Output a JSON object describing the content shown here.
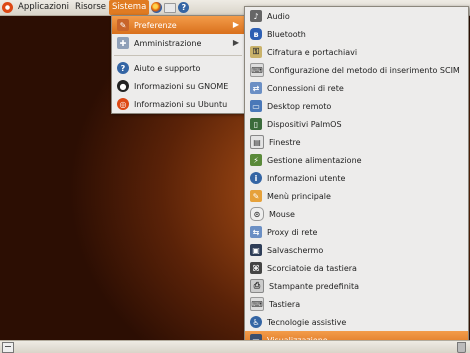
{
  "top_panel": {
    "menus": [
      "Applicazioni",
      "Risorse",
      "Sistema"
    ]
  },
  "sistema_menu": {
    "items": [
      {
        "label": "Preferenze",
        "icon": "preferences-icon"
      },
      {
        "label": "Amministrazione",
        "icon": "administration-icon"
      }
    ],
    "help_items": [
      {
        "label": "Aiuto e supporto",
        "icon": "help-icon"
      },
      {
        "label": "Informazioni su GNOME",
        "icon": "gnome-icon"
      },
      {
        "label": "Informazioni su Ubuntu",
        "icon": "ubuntu-icon"
      }
    ]
  },
  "preferenze_menu": {
    "items": [
      {
        "label": "Audio",
        "icon": "audio-icon"
      },
      {
        "label": "Bluetooth",
        "icon": "bluetooth-icon"
      },
      {
        "label": "Cifratura e portachiavi",
        "icon": "encryption-icon"
      },
      {
        "label": "Configurazione del metodo di inserimento SCIM",
        "icon": "keyboard-input-icon"
      },
      {
        "label": "Connessioni di rete",
        "icon": "network-icon"
      },
      {
        "label": "Desktop remoto",
        "icon": "remote-desktop-icon"
      },
      {
        "label": "Dispositivi PalmOS",
        "icon": "palm-device-icon"
      },
      {
        "label": "Finestre",
        "icon": "windows-icon"
      },
      {
        "label": "Gestione alimentazione",
        "icon": "power-icon"
      },
      {
        "label": "Informazioni utente",
        "icon": "user-info-icon"
      },
      {
        "label": "Menù principale",
        "icon": "main-menu-icon"
      },
      {
        "label": "Mouse",
        "icon": "mouse-icon"
      },
      {
        "label": "Proxy di rete",
        "icon": "proxy-icon"
      },
      {
        "label": "Salvaschermo",
        "icon": "screensaver-icon"
      },
      {
        "label": "Scorciatoie da tastiera",
        "icon": "shortcuts-icon"
      },
      {
        "label": "Stampante predefinita",
        "icon": "printer-icon"
      },
      {
        "label": "Tastiera",
        "icon": "keyboard-icon"
      },
      {
        "label": "Tecnologie assistive",
        "icon": "accessibility-icon"
      },
      {
        "label": "Visualizzazione",
        "icon": "display-icon"
      }
    ]
  },
  "colors": {
    "highlight": "#e07b22",
    "menu_bg": "#edeceb",
    "desktop": "#8a3d10"
  }
}
